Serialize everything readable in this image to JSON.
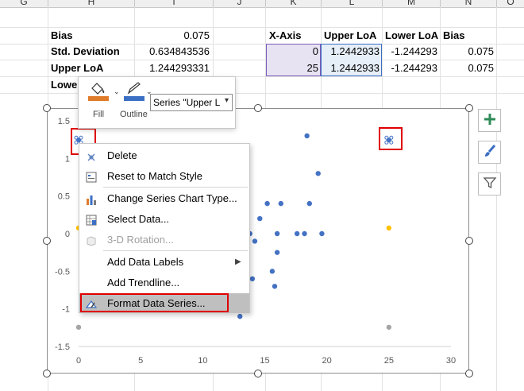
{
  "columns": [
    "G",
    "H",
    "I",
    "J",
    "K",
    "L",
    "M",
    "N",
    "O"
  ],
  "cells": {
    "bias_label": "Bias",
    "bias_value": "0.075",
    "std_label": "Std. Deviation",
    "std_value": "0.634843536",
    "upper_label": "Upper LoA",
    "upper_value": "1.244293331",
    "lower_label_partial": "Lowe"
  },
  "table": {
    "headers": [
      "X-Axis",
      "Upper LoA",
      "Lower LoA",
      "Bias"
    ],
    "rows": [
      [
        "0",
        "1.2442933",
        "-1.244293",
        "0.075"
      ],
      [
        "25",
        "1.2442933",
        "-1.244293",
        "0.075"
      ]
    ]
  },
  "mini_toolbar": {
    "fill_label": "Fill",
    "outline_label": "Outline",
    "series_select_value": "Series \"Upper L",
    "fill_color": "#e07b2a",
    "outline_color": "#3b6fc4"
  },
  "context_menu": {
    "items": [
      {
        "label": "Delete",
        "icon": "delete-icon",
        "disabled": false
      },
      {
        "label": "Reset to Match Style",
        "icon": "reset-style-icon",
        "disabled": false
      },
      {
        "label": "Change Series Chart Type...",
        "icon": "chart-type-icon",
        "disabled": false
      },
      {
        "label": "Select Data...",
        "icon": "select-data-icon",
        "disabled": false
      },
      {
        "label": "3-D Rotation...",
        "icon": "rotation-3d-icon",
        "disabled": true
      },
      {
        "label": "Add Data Labels",
        "icon": "",
        "disabled": false,
        "submenu": true
      },
      {
        "label": "Add Trendline...",
        "icon": "",
        "disabled": false
      },
      {
        "label": "Format Data Series...",
        "icon": "format-series-icon",
        "disabled": false,
        "highlighted": true
      }
    ]
  },
  "chart_data": {
    "type": "scatter",
    "xlim": [
      0,
      30
    ],
    "ylim": [
      -1.5,
      1.5
    ],
    "x_ticks": [
      "0",
      "5",
      "10",
      "15",
      "20",
      "25",
      "30"
    ],
    "y_ticks": [
      "1.5",
      "1",
      "0.5",
      "0",
      "-0.5",
      "-1",
      "-1.5"
    ],
    "series": [
      {
        "color": "#4472c4",
        "points": [
          [
            12.6,
            -0.3
          ],
          [
            13.0,
            -0.1
          ],
          [
            13.4,
            0.1
          ],
          [
            13.8,
            0.0
          ],
          [
            14.2,
            -0.1
          ],
          [
            14.6,
            0.2
          ],
          [
            15.2,
            0.4
          ],
          [
            15.6,
            -0.5
          ],
          [
            16.0,
            -0.25
          ],
          [
            16.0,
            0.0
          ],
          [
            16.3,
            0.4
          ],
          [
            17.6,
            0.0
          ],
          [
            18.2,
            0.0
          ],
          [
            18.6,
            0.4
          ],
          [
            19.3,
            0.8
          ],
          [
            19.6,
            0.0
          ],
          [
            18.4,
            1.3
          ],
          [
            15.8,
            -0.7
          ],
          [
            14.0,
            -0.6
          ],
          [
            13.0,
            -1.1
          ]
        ]
      },
      {
        "color": "#ffc000",
        "points": [
          [
            0,
            0.075
          ],
          [
            25,
            0.075
          ]
        ]
      },
      {
        "color": "#a5a5a5",
        "points": [
          [
            0,
            -1.244
          ],
          [
            25,
            -1.244
          ]
        ]
      },
      {
        "color": "#4472c4",
        "marker": "selected",
        "points": [
          [
            0,
            1.244
          ],
          [
            25,
            1.244
          ]
        ]
      }
    ]
  }
}
